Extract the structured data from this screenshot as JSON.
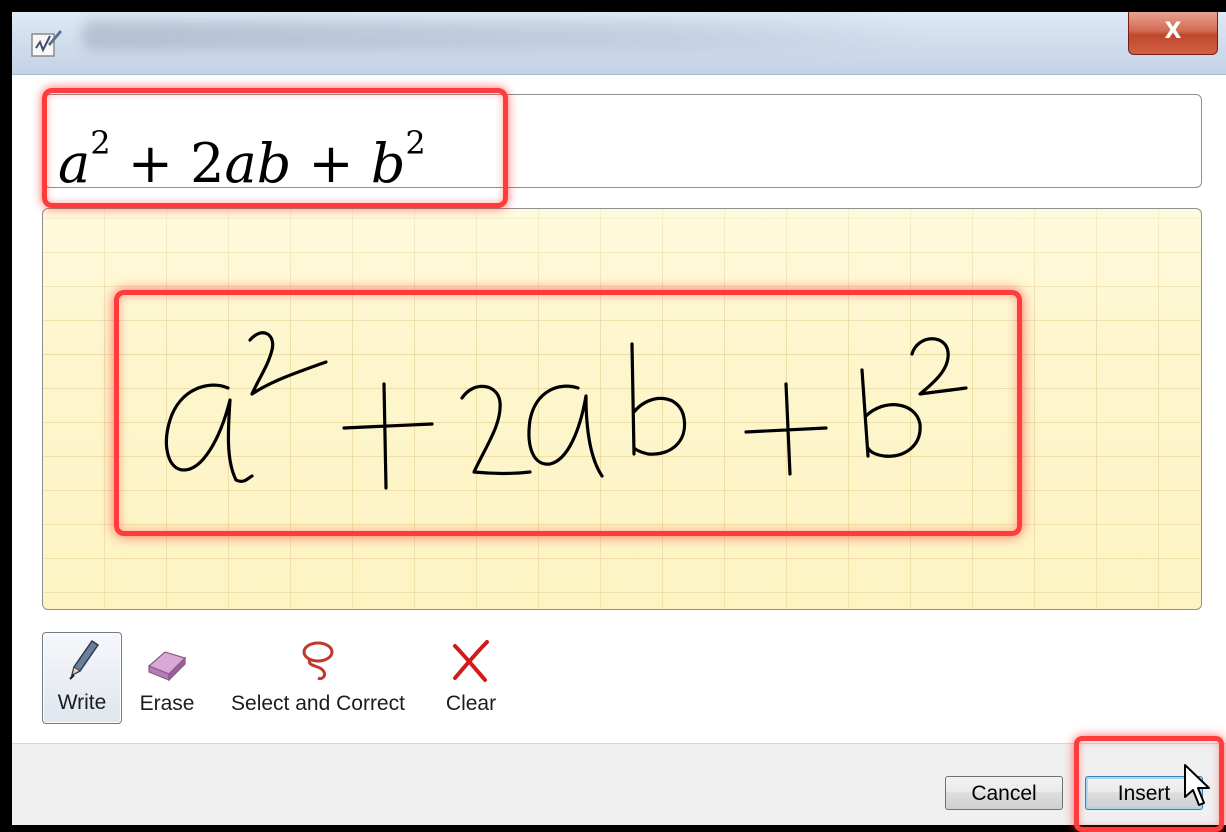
{
  "titlebar": {
    "close_label": "X"
  },
  "result": {
    "parts": [
      "a",
      "2",
      " + 2",
      "ab",
      " + ",
      "b",
      "2"
    ]
  },
  "toolbar": {
    "tools": [
      {
        "label": "Write",
        "icon": "pen-icon",
        "selected": true
      },
      {
        "label": "Erase",
        "icon": "eraser-icon",
        "selected": false
      },
      {
        "label": "Select and Correct",
        "icon": "lasso-icon",
        "selected": false
      },
      {
        "label": "Clear",
        "icon": "clear-x-icon",
        "selected": false
      }
    ]
  },
  "footer": {
    "cancel_label": "Cancel",
    "insert_label": "Insert"
  },
  "colors": {
    "highlight": "#ff3b3b",
    "ink_background": "#fdf6cd",
    "ink_grid": "#dabe78",
    "default_button_border": "#3c7fb1"
  }
}
